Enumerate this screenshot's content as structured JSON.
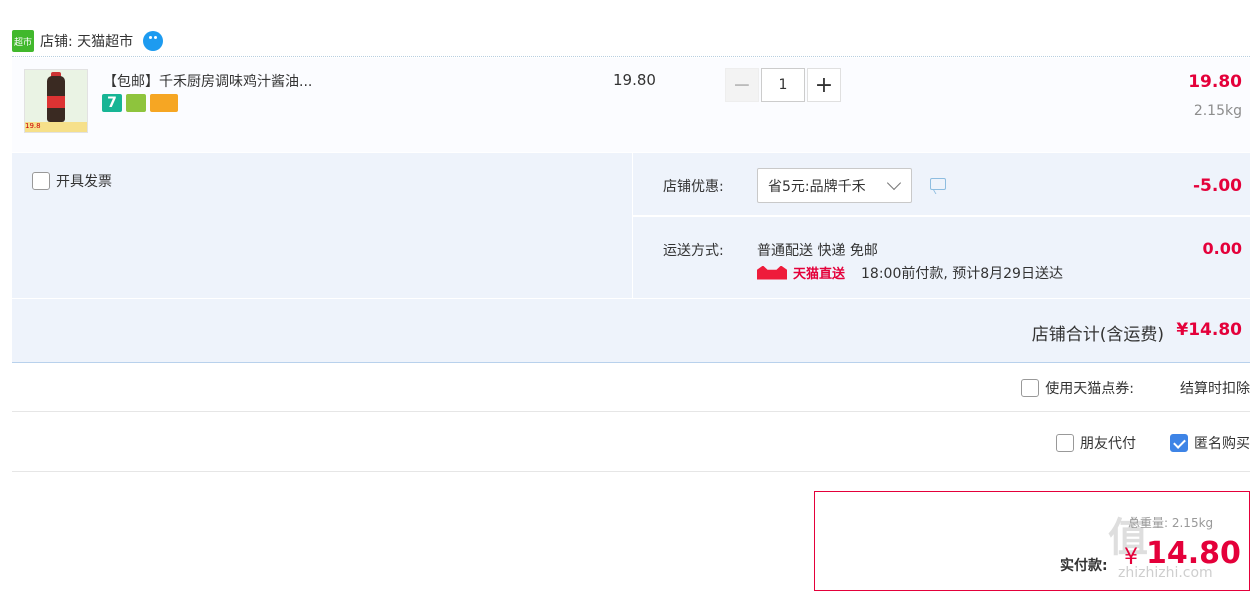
{
  "store": {
    "logo_text": "超市",
    "label": "店铺: 天猫超市"
  },
  "item": {
    "title": "【包邮】千禾厨房调味鸡汁酱油...",
    "thumb_price": "19.8",
    "unit_price": "19.80",
    "quantity": "1",
    "minus_symbol": "−",
    "plus_symbol": "+",
    "subtotal": "19.80",
    "weight": "2.15kg",
    "tags": [
      "7",
      "shield-tag-icon",
      "card-tag-icon"
    ]
  },
  "invoice": {
    "label": "开具发票",
    "checked": false
  },
  "promo": {
    "label": "店铺优惠:",
    "selected": "省5元:品牌千禾",
    "amount": "-5.00"
  },
  "shipping": {
    "label": "运送方式:",
    "method": "普通配送 快递 免邮",
    "direct_label": "天猫直送",
    "time_note": "18:00前付款, 预计8月29日送达",
    "cost": "0.00"
  },
  "total": {
    "label": "店铺合计(含运费)",
    "value": "¥14.80"
  },
  "points": {
    "label": "使用天猫点券:",
    "note": "结算时扣除"
  },
  "options": {
    "friend_pay": "朋友代付",
    "anonymous": "匿名购买"
  },
  "pay": {
    "weight_line": "总重量: 2.15kg",
    "label": "实付款:",
    "currency": "¥",
    "amount": "14.80"
  },
  "watermark": {
    "mark": "值",
    "site": "zhizhizhi.com"
  },
  "colors": {
    "accent": "#e4003a",
    "section_bg": "#eef3fb",
    "check_blue": "#3e84e6"
  }
}
